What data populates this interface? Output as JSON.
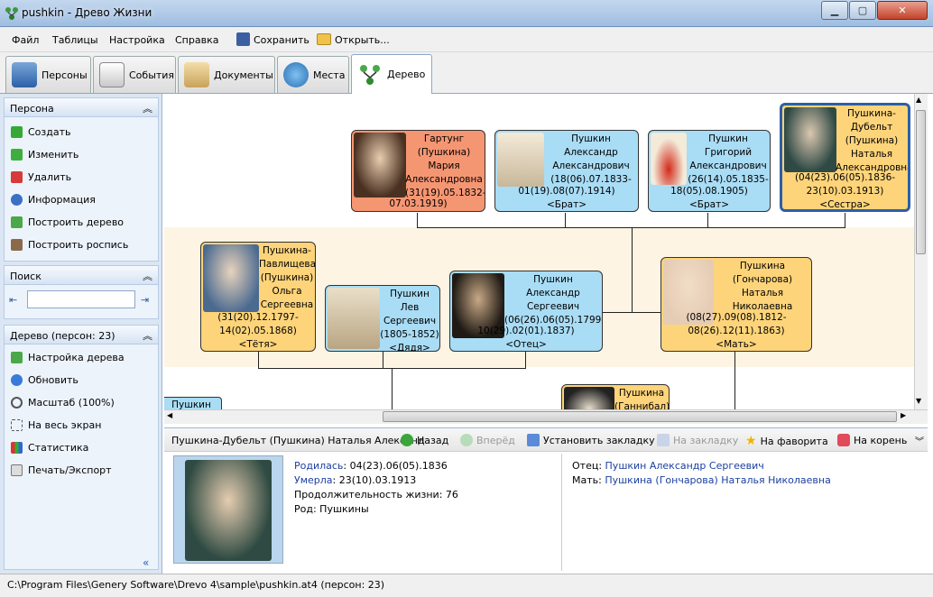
{
  "window": {
    "title": "pushkin - Древо Жизни"
  },
  "menu": [
    "Файл",
    "Таблицы",
    "Настройка",
    "Справка"
  ],
  "toolbar": {
    "save": "Сохранить",
    "open": "Открыть..."
  },
  "tabs": [
    "Персоны",
    "События",
    "Документы",
    "Места",
    "Дерево"
  ],
  "sidebar": {
    "person_head": "Персона",
    "person_items": [
      "Создать",
      "Изменить",
      "Удалить",
      "Информация",
      "Построить дерево",
      "Построить роспись"
    ],
    "search_head": "Поиск",
    "tree_head": "Дерево (персон: 23)",
    "tree_items": [
      "Настройка дерева",
      "Обновить",
      "Масштаб (100%)",
      "На весь экран",
      "Статистика",
      "Печать/Экспорт"
    ]
  },
  "cards": {
    "c1": [
      "Гартунг",
      "(Пушкина)",
      "Мария",
      "Александровна",
      "(31(19).05.1832-",
      "07.03.1919)"
    ],
    "c2": [
      "Пушкин",
      "Александр",
      "Александрович",
      "(18(06).07.1833-",
      "01(19).08(07).1914)",
      "<Брат>"
    ],
    "c3": [
      "Пушкин",
      "Григорий",
      "Александрович",
      "(26(14).05.1835-",
      "18(05).08.1905)",
      "<Брат>"
    ],
    "c4": [
      "Пушкина-",
      "Дубельт",
      "(Пушкина)",
      "Наталья",
      "Александровна",
      "(04(23).06(05).1836-",
      "23(10).03.1913)",
      "<Сестра>"
    ],
    "c5": [
      "Пушкина-",
      "Павлищева",
      "(Пушкина)",
      "Ольга",
      "Сергеевна",
      "(31(20).12.1797-",
      "14(02).05.1868)",
      "<Тётя>"
    ],
    "c6": [
      "Пушкин Лев",
      "Сергеевич",
      "(1805-1852)",
      "<Дядя>"
    ],
    "c7": [
      "Пушкин",
      "Александр",
      "Сергеевич",
      "(06(26).06(05).1799-",
      "10(29).02(01).1837)",
      "<Отец>"
    ],
    "c8": [
      "Пушкина",
      "(Гончарова)",
      "Наталья",
      "Николаевна",
      "(08(27).09(08).1812-",
      "08(26).12(11).1863)",
      "<Мать>"
    ],
    "c9": [
      "Пушкина",
      "(Ганнибал)"
    ],
    "c10": [
      "Пушкин"
    ]
  },
  "infobar": {
    "name": "Пушкина-Дубельт (Пушкина) Наталья Александ",
    "back": "Назад",
    "forward": "Вперёд",
    "bookmark": "Установить закладку",
    "to_bookmark": "На закладку",
    "favorite": "На фаворита",
    "root": "На корень"
  },
  "info": {
    "born_label": "Родилась",
    "born": ": 04(23).06(05).1836",
    "died_label": "Умерла",
    "died": ": 23(10).03.1913",
    "life": "Продолжительность жизни: 76",
    "clan": "Род: Пушкины",
    "father_label": "Отец: ",
    "father": "Пушкин Александр Сергеевич",
    "mother_label": "Мать: ",
    "mother": "Пушкина (Гончарова) Наталья Николаевна"
  },
  "status": "C:\\Program Files\\Genery Software\\Drevo 4\\sample\\pushkin.at4 (персон: 23)",
  "colors": {
    "female": "#fdd47a",
    "male": "#a9dcf5",
    "selected_border": "#2d5fa8",
    "red_card": "#f59673"
  }
}
